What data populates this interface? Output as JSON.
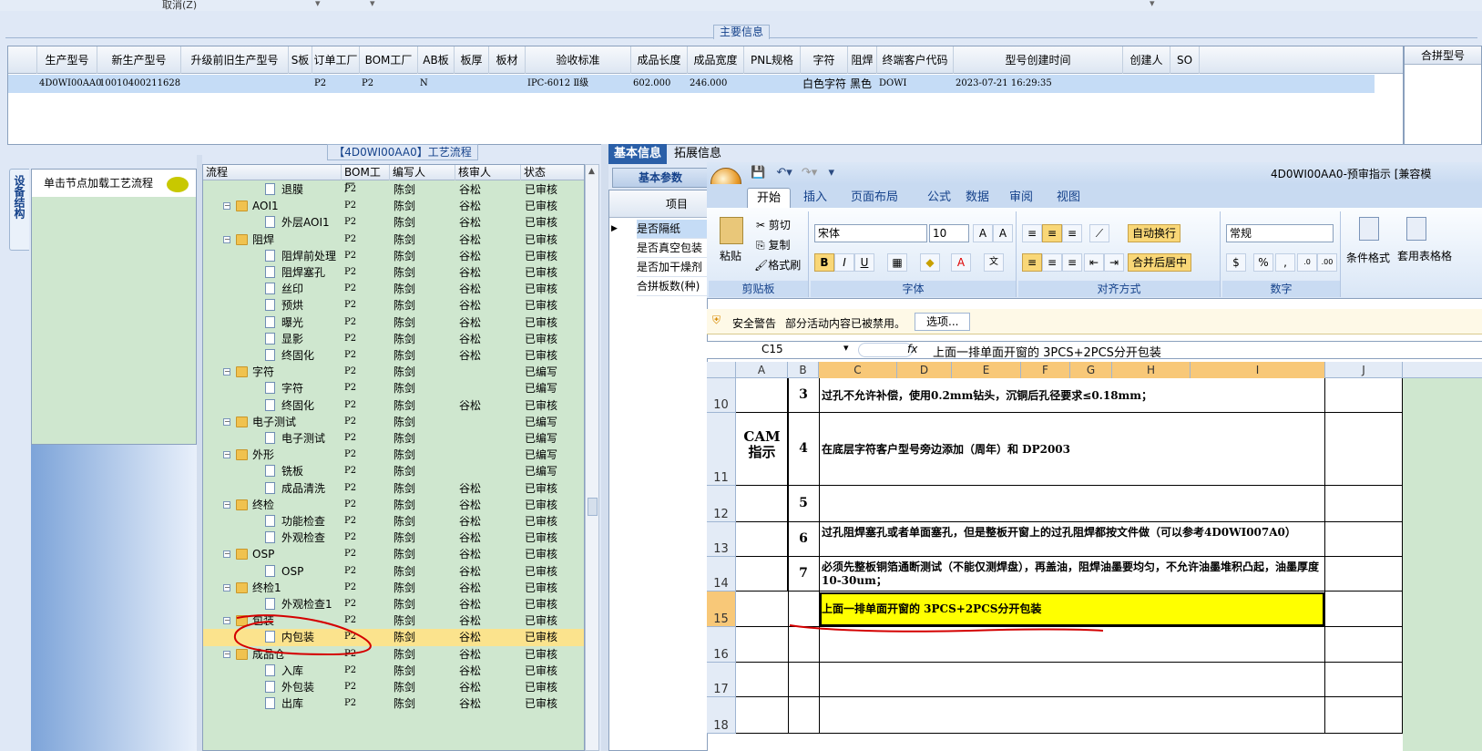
{
  "top_toolbar": {
    "cancel_label": "取消(Z)"
  },
  "main_info": {
    "title": "主要信息",
    "columns": [
      "生产型号",
      "新生产型号",
      "升级前旧生产型号",
      "S板",
      "订单工厂",
      "BOM工厂",
      "AB板",
      "板厚",
      "板材",
      "验收标准",
      "成品长度",
      "成品宽度",
      "PNL规格",
      "字符",
      "阻焊",
      "终端客户代码",
      "型号创建时间",
      "创建人",
      "SO"
    ],
    "row": {
      "c0": "4D0WI00AA0",
      "c1": "10010400211628",
      "c4": "P2",
      "c5": "P2",
      "c6": "N",
      "c9": "IPC-6012 Ⅱ级",
      "c10": "602.000",
      "c11": "246.000",
      "c13": "白色字符",
      "c14": "黑色",
      "c15": "DOWI",
      "c16": "2023-07-21 16:29:35"
    },
    "merge_header": "合拼型号"
  },
  "left_panel": {
    "tab_label": "设备结构",
    "hint": "单击节点加载工艺流程"
  },
  "process_tree": {
    "title": "【4D0WI00AA0】工艺流程",
    "headers": [
      "流程",
      "BOM工厂",
      "编写人",
      "核审人",
      "状态"
    ],
    "rows": [
      {
        "name": "退膜",
        "type": "doc",
        "bom": "P2",
        "writer": "陈剑",
        "reviewer": "谷松",
        "status": "已审核"
      },
      {
        "name": "AOI1",
        "type": "folder",
        "bom": "P2",
        "writer": "陈剑",
        "reviewer": "谷松",
        "status": "已审核"
      },
      {
        "name": "外层AOI1",
        "type": "doc",
        "bom": "P2",
        "writer": "陈剑",
        "reviewer": "谷松",
        "status": "已审核"
      },
      {
        "name": "阻焊",
        "type": "folder",
        "bom": "P2",
        "writer": "陈剑",
        "reviewer": "谷松",
        "status": "已审核"
      },
      {
        "name": "阻焊前处理",
        "type": "doc",
        "bom": "P2",
        "writer": "陈剑",
        "reviewer": "谷松",
        "status": "已审核"
      },
      {
        "name": "阻焊塞孔",
        "type": "doc",
        "bom": "P2",
        "writer": "陈剑",
        "reviewer": "谷松",
        "status": "已审核"
      },
      {
        "name": "丝印",
        "type": "doc",
        "bom": "P2",
        "writer": "陈剑",
        "reviewer": "谷松",
        "status": "已审核"
      },
      {
        "name": "预烘",
        "type": "doc",
        "bom": "P2",
        "writer": "陈剑",
        "reviewer": "谷松",
        "status": "已审核"
      },
      {
        "name": "曝光",
        "type": "doc",
        "bom": "P2",
        "writer": "陈剑",
        "reviewer": "谷松",
        "status": "已审核"
      },
      {
        "name": "显影",
        "type": "doc",
        "bom": "P2",
        "writer": "陈剑",
        "reviewer": "谷松",
        "status": "已审核"
      },
      {
        "name": "终固化",
        "type": "doc",
        "bom": "P2",
        "writer": "陈剑",
        "reviewer": "谷松",
        "status": "已审核"
      },
      {
        "name": "字符",
        "type": "folder",
        "bom": "P2",
        "writer": "陈剑",
        "reviewer": "",
        "status": "已编写"
      },
      {
        "name": "字符",
        "type": "doc",
        "bom": "P2",
        "writer": "陈剑",
        "reviewer": "",
        "status": "已编写"
      },
      {
        "name": "终固化",
        "type": "doc",
        "bom": "P2",
        "writer": "陈剑",
        "reviewer": "谷松",
        "status": "已审核"
      },
      {
        "name": "电子测试",
        "type": "folder",
        "bom": "P2",
        "writer": "陈剑",
        "reviewer": "",
        "status": "已编写"
      },
      {
        "name": "电子测试",
        "type": "doc",
        "bom": "P2",
        "writer": "陈剑",
        "reviewer": "",
        "status": "已编写"
      },
      {
        "name": "外形",
        "type": "folder",
        "bom": "P2",
        "writer": "陈剑",
        "reviewer": "",
        "status": "已编写"
      },
      {
        "name": "铣板",
        "type": "doc",
        "bom": "P2",
        "writer": "陈剑",
        "reviewer": "",
        "status": "已编写"
      },
      {
        "name": "成品清洗",
        "type": "doc",
        "bom": "P2",
        "writer": "陈剑",
        "reviewer": "谷松",
        "status": "已审核"
      },
      {
        "name": "终检",
        "type": "folder",
        "bom": "P2",
        "writer": "陈剑",
        "reviewer": "谷松",
        "status": "已审核"
      },
      {
        "name": "功能检查",
        "type": "doc",
        "bom": "P2",
        "writer": "陈剑",
        "reviewer": "谷松",
        "status": "已审核"
      },
      {
        "name": "外观检查",
        "type": "doc",
        "bom": "P2",
        "writer": "陈剑",
        "reviewer": "谷松",
        "status": "已审核"
      },
      {
        "name": "OSP",
        "type": "folder",
        "bom": "P2",
        "writer": "陈剑",
        "reviewer": "谷松",
        "status": "已审核"
      },
      {
        "name": "OSP",
        "type": "doc",
        "bom": "P2",
        "writer": "陈剑",
        "reviewer": "谷松",
        "status": "已审核"
      },
      {
        "name": "终检1",
        "type": "folder",
        "bom": "P2",
        "writer": "陈剑",
        "reviewer": "谷松",
        "status": "已审核"
      },
      {
        "name": "外观检查1",
        "type": "doc",
        "bom": "P2",
        "writer": "陈剑",
        "reviewer": "谷松",
        "status": "已审核"
      },
      {
        "name": "包装",
        "type": "folder",
        "bom": "P2",
        "writer": "陈剑",
        "reviewer": "谷松",
        "status": "已审核"
      },
      {
        "name": "内包装",
        "type": "doc",
        "bom": "P2",
        "writer": "陈剑",
        "reviewer": "谷松",
        "status": "已审核",
        "selected": true
      },
      {
        "name": "成品仓",
        "type": "folder",
        "bom": "P2",
        "writer": "陈剑",
        "reviewer": "谷松",
        "status": "已审核"
      },
      {
        "name": "入库",
        "type": "doc",
        "bom": "P2",
        "writer": "陈剑",
        "reviewer": "谷松",
        "status": "已审核"
      },
      {
        "name": "外包装",
        "type": "doc",
        "bom": "P2",
        "writer": "陈剑",
        "reviewer": "谷松",
        "status": "已审核"
      },
      {
        "name": "出库",
        "type": "doc",
        "bom": "P2",
        "writer": "陈剑",
        "reviewer": "谷松",
        "status": "已审核"
      }
    ]
  },
  "right_tabs": {
    "basic": "基本信息",
    "ext": "拓展信息",
    "subtab": "基本参数",
    "prop_header": "项目"
  },
  "props": [
    "是否隔纸",
    "是否真空包装",
    "是否加干燥剂",
    "合拼板数(种)"
  ],
  "excel": {
    "title": "4D0WI00AA0-预审指示 [兼容模",
    "ribbon_tabs": [
      "开始",
      "插入",
      "页面布局",
      "公式",
      "数据",
      "审阅",
      "视图"
    ],
    "clipboard": {
      "paste": "粘贴",
      "cut": "剪切",
      "copy": "复制",
      "format": "格式刷",
      "label": "剪贴板"
    },
    "font": {
      "name": "宋体",
      "size": "10",
      "label": "字体"
    },
    "align": {
      "wrap": "自动换行",
      "merge": "合并后居中",
      "label": "对齐方式"
    },
    "number": {
      "format": "常规",
      "label": "数字",
      "percent": "%",
      "comma": ","
    },
    "styles": {
      "cond": "条件格式",
      "table": "套用表格格"
    },
    "security": {
      "label": "安全警告",
      "msg": "部分活动内容已被禁用。",
      "btn": "选项..."
    },
    "name_box": "C15",
    "formula": "上面一排单面开窗的 3PCS+2PCS分开包装",
    "col_headers": [
      "A",
      "B",
      "C",
      "D",
      "E",
      "F",
      "G",
      "H",
      "I",
      "J"
    ],
    "cam_label": "CAM\n指示",
    "rows": [
      {
        "row": "10",
        "num": "3",
        "text": "过孔不允许补偿，使用0.2mm钻头，沉铜后孔径要求≤0.18mm；"
      },
      {
        "row": "11",
        "num": "4",
        "text": "在底层字符客户型号旁边添加（周年）和  DP2003"
      },
      {
        "row": "12",
        "num": "5",
        "text": ""
      },
      {
        "row": "13",
        "num": "6",
        "text": "过孔阻焊塞孔或者单面塞孔，但是整板开窗上的过孔阻焊都按文件做（可以参考4D0WI007A0）"
      },
      {
        "row": "14",
        "num": "7",
        "text": "必须先整板铜箔通断测试（不能仅测焊盘），再盖油，阻焊油墨要均匀，不允许油墨堆积凸起，油墨厚度10-30um；"
      },
      {
        "row": "15",
        "num": "",
        "text": "上面一排单面开窗的 3PCS+2PCS分开包装"
      },
      {
        "row": "16",
        "num": "",
        "text": ""
      },
      {
        "row": "17",
        "num": "",
        "text": ""
      },
      {
        "row": "18",
        "num": "",
        "text": ""
      }
    ]
  }
}
